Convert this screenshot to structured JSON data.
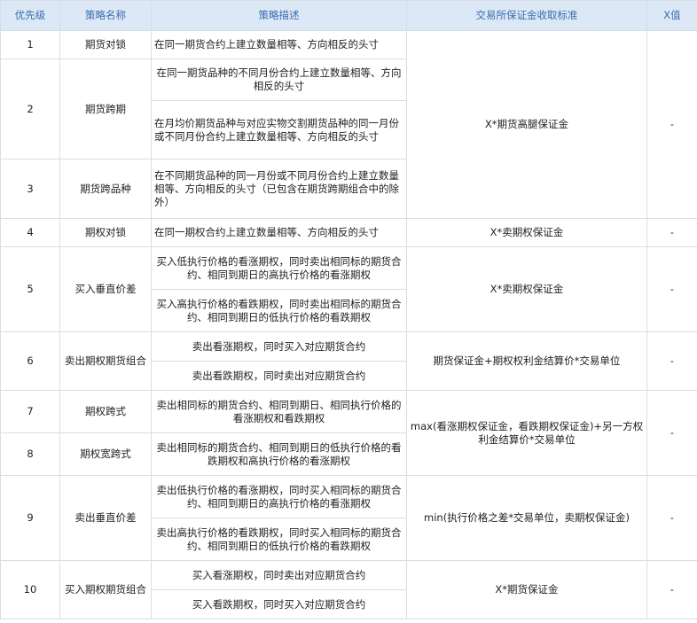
{
  "headers": [
    "优先级",
    "策略名称",
    "策略描述",
    "交易所保证金收取标准",
    "X值"
  ],
  "rows": [
    {
      "priority": "1",
      "name": "期货对锁",
      "descriptions": [
        "在同一期货合约上建立数量相等、方向相反的头寸"
      ]
    },
    {
      "priority": "2",
      "name": "期货跨期",
      "descriptions": [
        "在同一期货品种的不同月份合约上建立数量相等、方向相反的头寸",
        "在月均价期货品种与对应实物交割期货品种的同一月份或不同月份合约上建立数量相等、方向相反的头寸"
      ]
    },
    {
      "priority": "3",
      "name": "期货跨品种",
      "descriptions": [
        "在不同期货品种的同一月份或不同月份合约上建立数量相等、方向相反的头寸（已包含在期货跨期组合中的除外）"
      ]
    },
    {
      "priority": "4",
      "name": "期权对锁",
      "descriptions": [
        "在同一期权合约上建立数量相等、方向相反的头寸"
      ]
    },
    {
      "priority": "5",
      "name": "买入垂直价差",
      "descriptions": [
        "买入低执行价格的看涨期权，同时卖出相同标的期货合约、相同到期日的高执行价格的看涨期权",
        "买入高执行价格的看跌期权，同时卖出相同标的期货合约、相同到期日的低执行价格的看跌期权"
      ]
    },
    {
      "priority": "6",
      "name": "卖出期权期货组合",
      "descriptions": [
        "卖出看涨期权，同时买入对应期货合约",
        "卖出看跌期权，同时卖出对应期货合约"
      ]
    },
    {
      "priority": "7",
      "name": "期权跨式",
      "descriptions": [
        "卖出相同标的期货合约、相同到期日、相同执行价格的看涨期权和看跌期权"
      ]
    },
    {
      "priority": "8",
      "name": "期权宽跨式",
      "descriptions": [
        "卖出相同标的期货合约、相同到期日的低执行价格的看跌期权和高执行价格的看涨期权"
      ]
    },
    {
      "priority": "9",
      "name": "卖出垂直价差",
      "descriptions": [
        "卖出低执行价格的看涨期权，同时买入相同标的期货合约、相同到期日的高执行价格的看涨期权",
        "卖出高执行价格的看跌期权，同时买入相同标的期货合约、相同到期日的低执行价格的看跌期权"
      ]
    },
    {
      "priority": "10",
      "name": "买入期权期货组合",
      "descriptions": [
        "买入看涨期权，同时卖出对应期货合约",
        "买入看跌期权，同时买入对应期货合约"
      ]
    }
  ],
  "margins": {
    "rows_1_3": "X*期货高腿保证金",
    "row_4": "X*卖期权保证金",
    "row_5": "X*卖期权保证金",
    "row_6": "期货保证金+期权权利金结算价*交易单位",
    "rows_7_8": "max(看涨期权保证金，看跌期权保证金)+另一方权利金结算价*交易单位",
    "row_9": "min(执行价格之差*交易单位，卖期权保证金)",
    "row_10": "X*期货保证金"
  },
  "xvals": {
    "rows_1_3": "-",
    "row_4": "-",
    "row_5": "-",
    "row_6": "-",
    "rows_7_8": "-",
    "row_9": "-",
    "row_10": "-"
  }
}
